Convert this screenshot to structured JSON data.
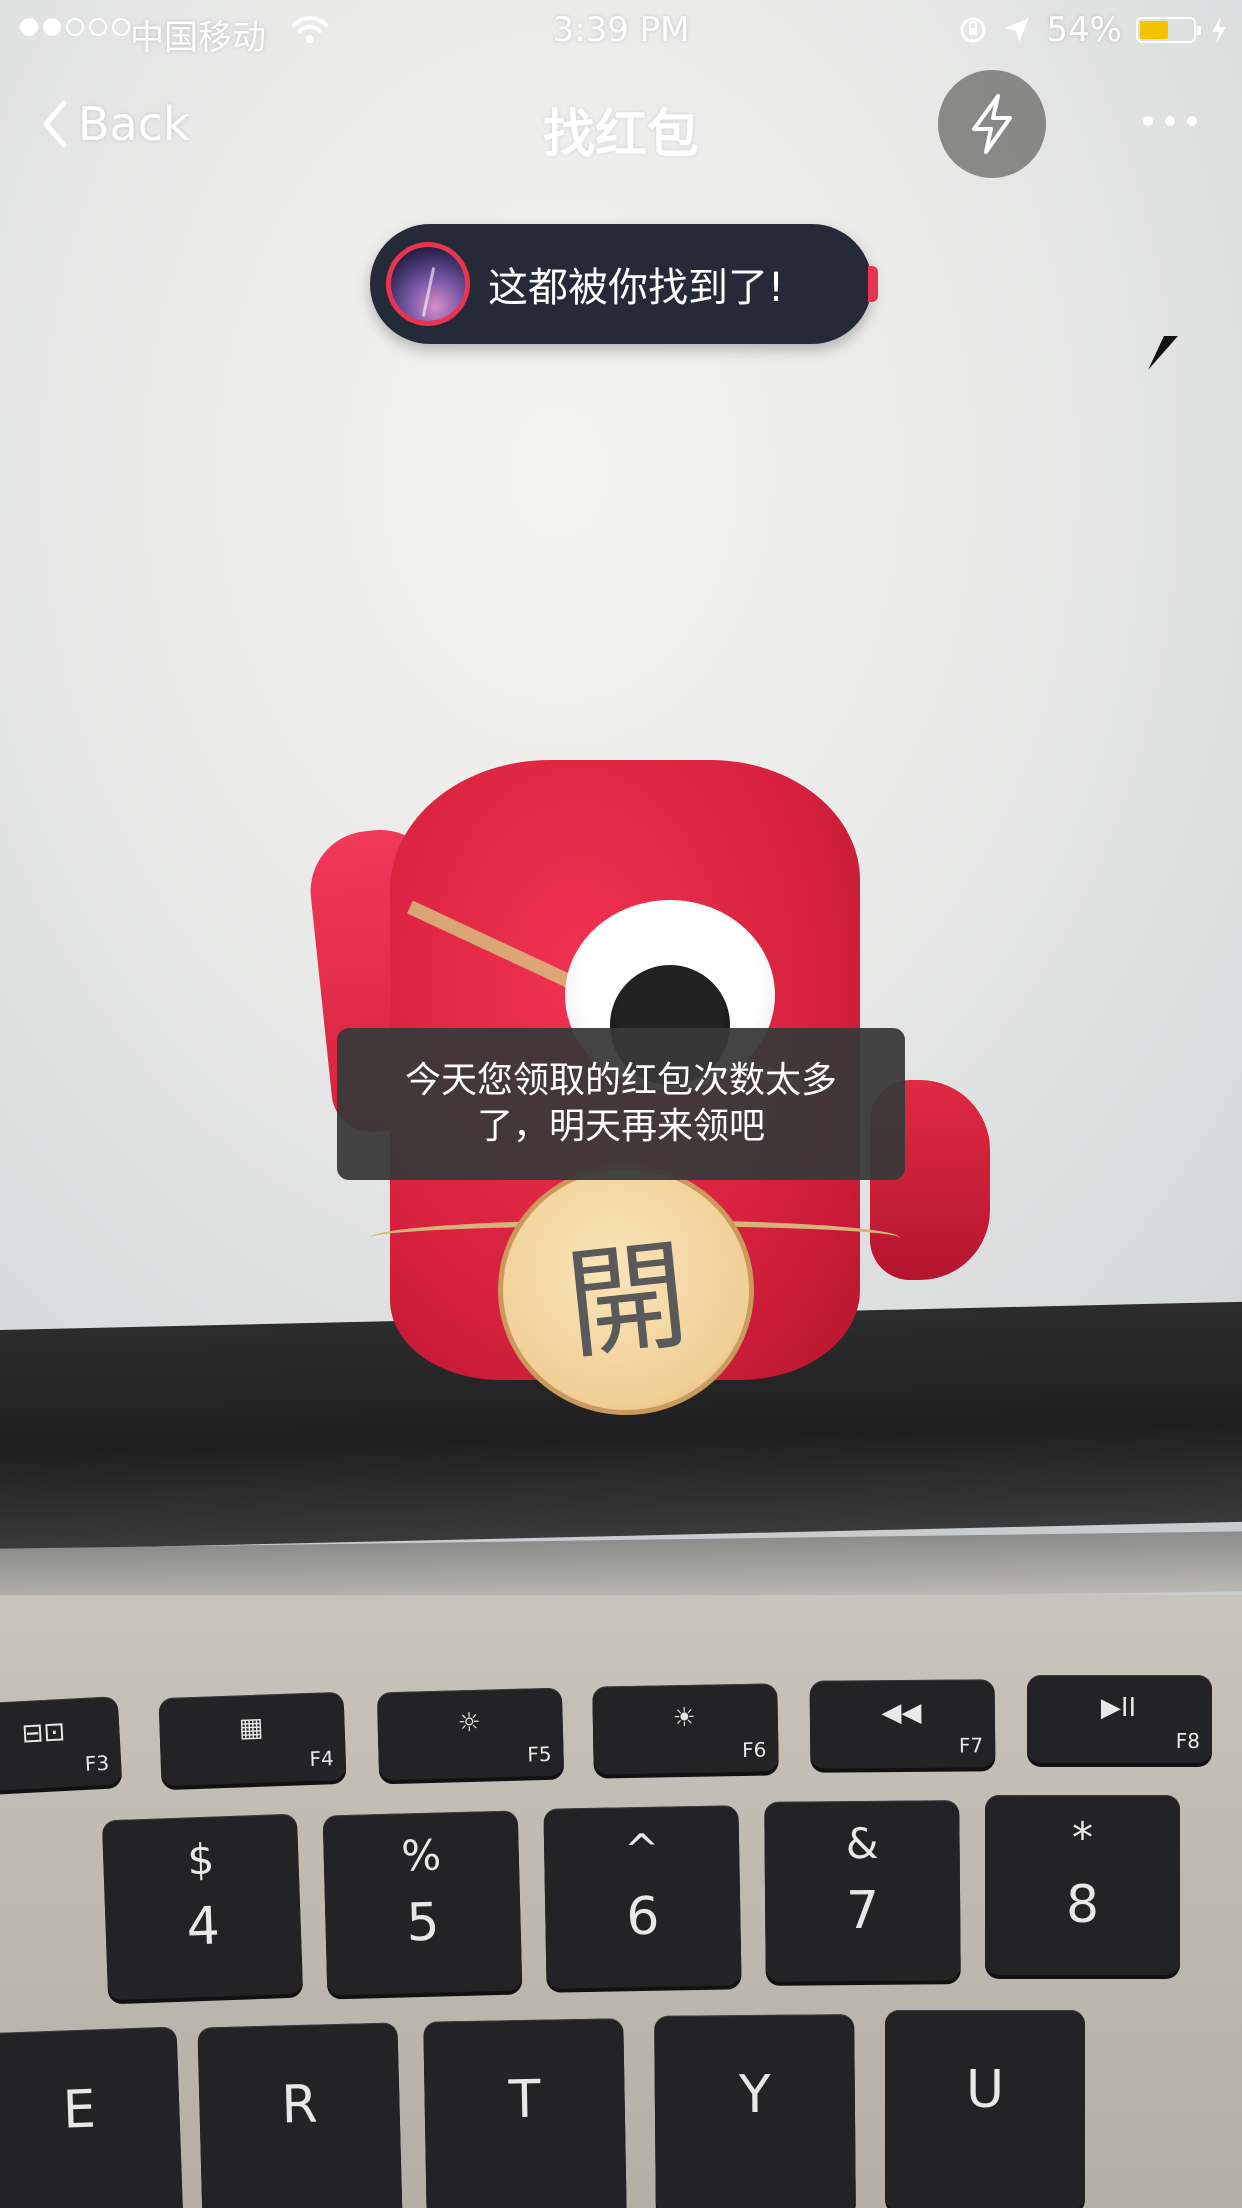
{
  "status_bar": {
    "signal_strength": "2 of 5 dots",
    "carrier": "中国移动",
    "time": "3:39 PM",
    "battery_percent": "54%",
    "battery_level": 0.54,
    "colors": {
      "battery_fill": "#f5c400"
    },
    "icons": [
      "wifi-icon",
      "orientation-lock-icon",
      "location-icon",
      "battery-icon",
      "charging-icon"
    ]
  },
  "nav": {
    "back_label": "Back",
    "title": "找红包",
    "icons": [
      "chevron-left-icon",
      "lightning-icon",
      "more-icon"
    ]
  },
  "found_banner": {
    "text": "这都被你找到了!",
    "accent": "#e8344f",
    "background": "#252a38"
  },
  "red_packet": {
    "open_glyph": "開"
  },
  "toast": {
    "line1": "今天您领取的红包次数太多",
    "line2": "了，明天再来领吧"
  },
  "keyboard": {
    "fn_keys": [
      {
        "fn": "F3",
        "glyph": "⊟⊡"
      },
      {
        "fn": "F4",
        "glyph": "▦"
      },
      {
        "fn": "F5",
        "glyph": "☼"
      },
      {
        "fn": "F6",
        "glyph": "☀"
      },
      {
        "fn": "F7",
        "glyph": "◀◀"
      },
      {
        "fn": "F8",
        "glyph": "▶II"
      }
    ],
    "number_keys": [
      {
        "top": "$",
        "main": "4"
      },
      {
        "top": "%",
        "main": "5"
      },
      {
        "top": "^",
        "main": "6"
      },
      {
        "top": "&",
        "main": "7"
      },
      {
        "top": "*",
        "main": "8"
      }
    ],
    "letter_keys": [
      "E",
      "R",
      "T",
      "Y",
      "U"
    ]
  }
}
